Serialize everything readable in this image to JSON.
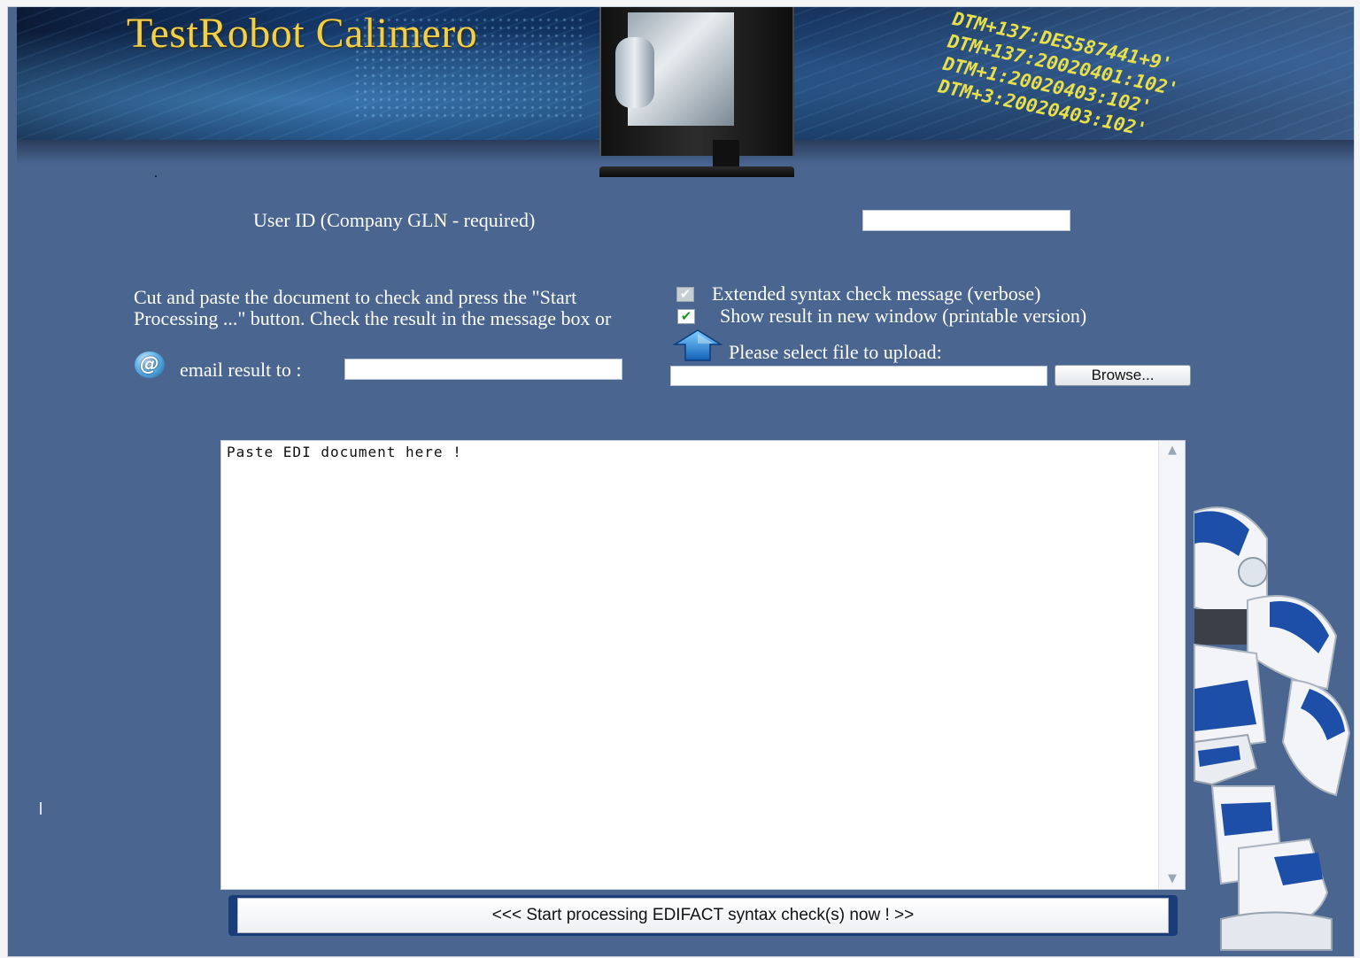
{
  "header": {
    "title": "TestRobot Calimero",
    "edi_code_lines": [
      "DTM+137:DES587441+9'",
      "DTM+137:20020401:102'",
      "DTM+1:20020403:102'",
      "DTM+3:20020403:102'"
    ]
  },
  "form": {
    "user_id_label": "User ID (Company GLN - required)",
    "user_id_value": "",
    "instructions": "Cut and paste the document to check and press the \"Start Processing ...\" button. Check the result in the message box or",
    "email_label": "email result to :",
    "email_value": "",
    "options": [
      {
        "label": "Extended syntax check message (verbose)",
        "checked": true,
        "disabled": true
      },
      {
        "label": "Show result in new window (printable version)",
        "checked": true,
        "disabled": false
      }
    ],
    "upload_label": "Please select file to upload:",
    "file_value": "",
    "browse_label": "Browse...",
    "edi_placeholder": "Paste EDI document here !",
    "start_label": "<<< Start processing EDIFACT syntax check(s) now ! >>"
  },
  "icons": {
    "email": "at-icon",
    "upload": "upload-arrow-icon",
    "checkbox_checked": "✔"
  },
  "colors": {
    "background": "#4a6690",
    "title": "#f2cf4a",
    "edi_code": "#e8e04a",
    "check": "#1a9a2a"
  }
}
